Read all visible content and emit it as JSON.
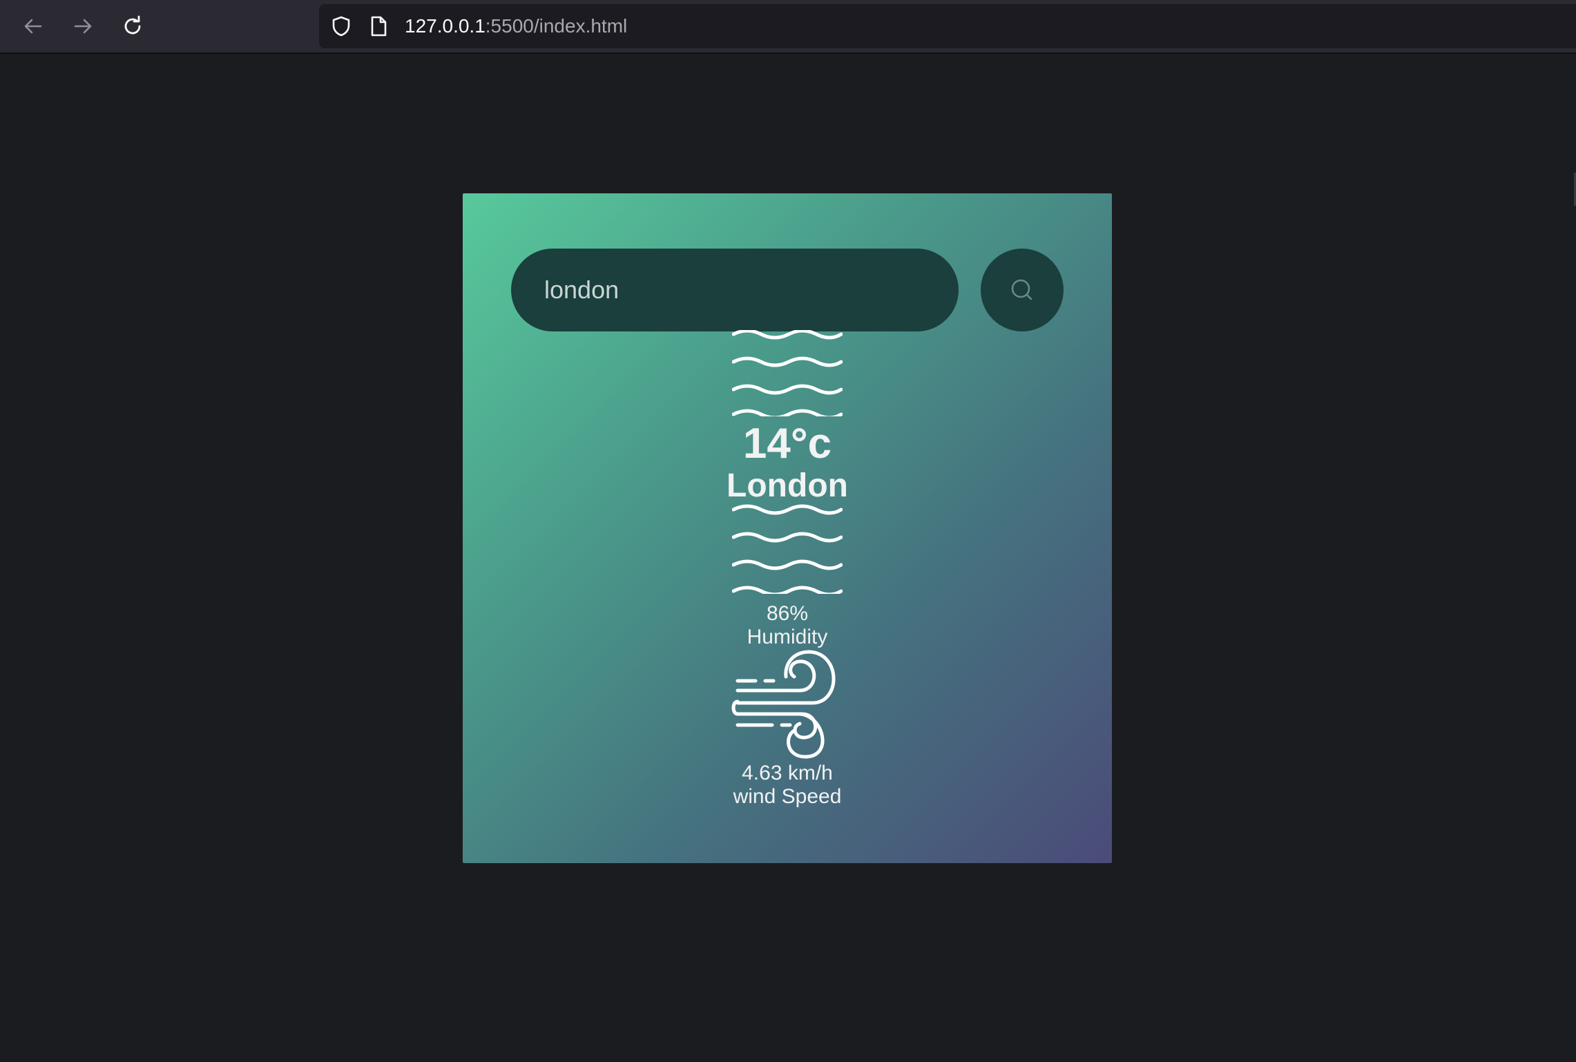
{
  "browser": {
    "url_host": "127.0.0.1",
    "url_rest": ":5500/index.html"
  },
  "search": {
    "value": "london"
  },
  "weather": {
    "temperature": "14°c",
    "city": "London",
    "humidity_value": "86%",
    "humidity_label": "Humidity",
    "wind_value": "4.63 km/h",
    "wind_label": "wind Speed",
    "condition_icon": "mist-icon"
  },
  "colors": {
    "page_background": "#1b1c1f",
    "gradient_start": "#58c99c",
    "gradient_end": "#4b4b78",
    "input_background": "#1a3f3c",
    "text": "#f2f2f2"
  }
}
